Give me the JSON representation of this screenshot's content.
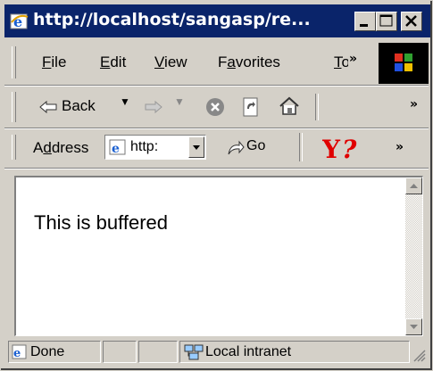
{
  "window": {
    "title": "http://localhost/sangasp/re..."
  },
  "menu": {
    "items": [
      {
        "label": "File",
        "key": "F"
      },
      {
        "label": "Edit",
        "key": "E"
      },
      {
        "label": "View",
        "key": "V"
      },
      {
        "label": "Favorites",
        "key": "a"
      },
      {
        "label": "Tools",
        "key": "T"
      }
    ],
    "overflow": "»"
  },
  "toolbar": {
    "back_label": "Back",
    "overflow": "»"
  },
  "address": {
    "label": "Address",
    "value": "http:",
    "go_label": "Go",
    "overflow": "»"
  },
  "page": {
    "text": "This is buffered"
  },
  "status": {
    "text": "Done",
    "zone": "Local intranet"
  },
  "colors": {
    "titlebar": "#0a246a",
    "chrome": "#d4d0c8",
    "yahoo_red": "#e00000"
  },
  "icons": [
    "ie-icon",
    "minimize-icon",
    "maximize-icon",
    "close-icon",
    "windows-logo-icon",
    "back-arrow-icon",
    "forward-arrow-icon",
    "stop-icon",
    "refresh-icon",
    "home-icon",
    "go-icon",
    "yahoo-logo-icon",
    "page-icon",
    "local-intranet-icon"
  ]
}
